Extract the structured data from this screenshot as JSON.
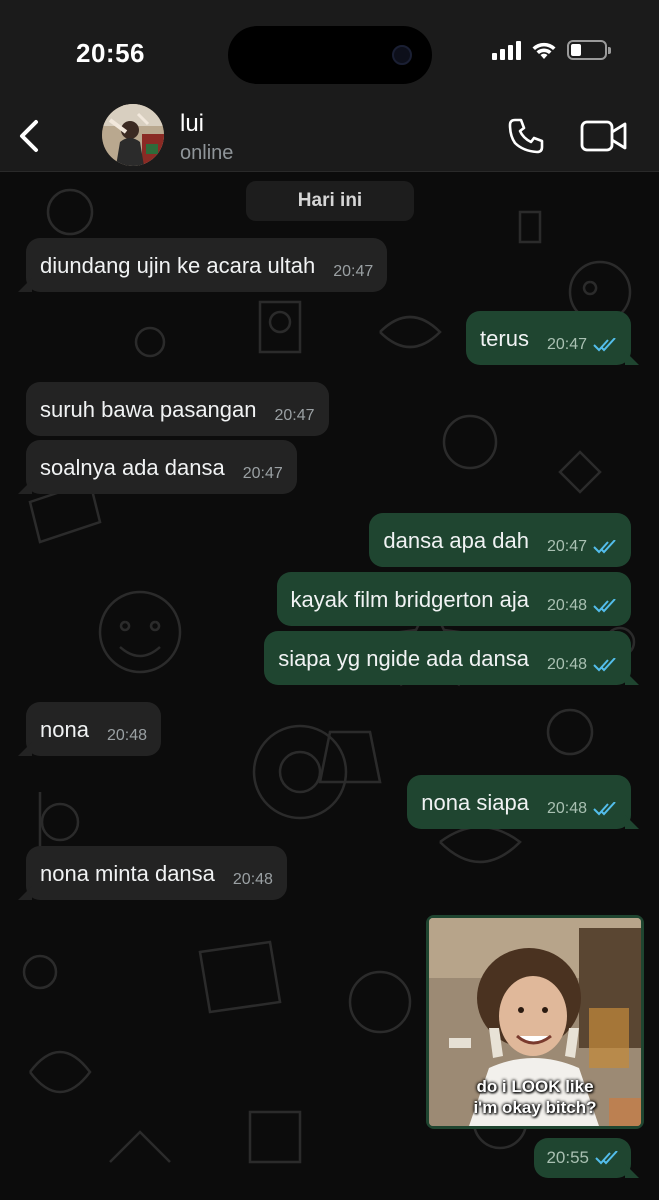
{
  "status_bar": {
    "time": "20:56",
    "battery_level": 0.3
  },
  "header": {
    "contact_name": "lui",
    "contact_status": "online",
    "icons": [
      "chevron-left-icon",
      "phone-icon",
      "video-camera-icon"
    ]
  },
  "chat": {
    "date_label": "Hari ini",
    "messages": [
      {
        "dir": "in",
        "text": "diundang ujin ke acara ultah",
        "time": "20:47"
      },
      {
        "dir": "out",
        "text": "terus",
        "time": "20:47",
        "status": "read"
      },
      {
        "dir": "in",
        "text": "suruh bawa pasangan",
        "time": "20:47"
      },
      {
        "dir": "in",
        "text": "soalnya ada dansa",
        "time": "20:47"
      },
      {
        "dir": "out",
        "text": "dansa apa dah",
        "time": "20:47",
        "status": "read"
      },
      {
        "dir": "out",
        "text": "kayak film bridgerton aja",
        "time": "20:48",
        "status": "read"
      },
      {
        "dir": "out",
        "text": "siapa yg ngide ada dansa",
        "time": "20:48",
        "status": "read"
      },
      {
        "dir": "in",
        "text": "nona",
        "time": "20:48"
      },
      {
        "dir": "out",
        "text": "nona siapa",
        "time": "20:48",
        "status": "read"
      },
      {
        "dir": "in",
        "text": "nona minta dansa",
        "time": "20:48"
      }
    ],
    "media": {
      "caption_line1": "do i LOOK like",
      "caption_line2": "i'm okay bitch?",
      "time": "20:55",
      "status": "read"
    }
  },
  "colors": {
    "incoming_bubble": "#232323",
    "outgoing_bubble": "#1f4530",
    "read_ticks": "#53bdeb",
    "header_bg": "#1b1b1b"
  }
}
